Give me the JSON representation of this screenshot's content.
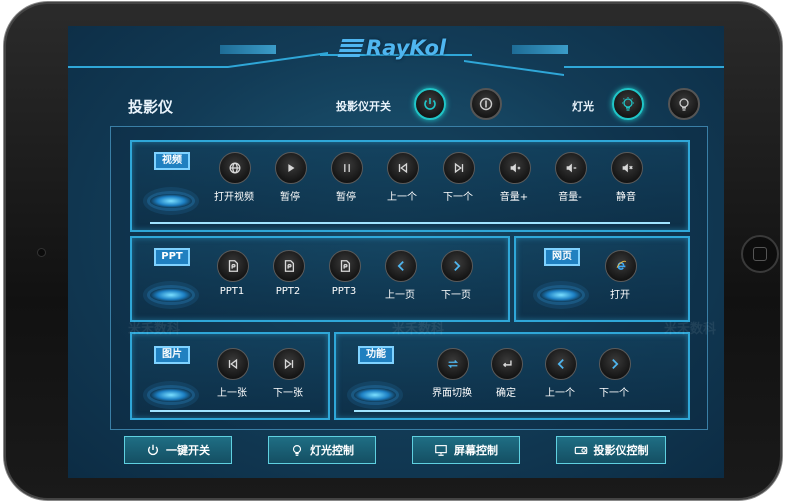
{
  "brand": {
    "logo": "RayKol"
  },
  "header": {
    "section_title": "投影仪",
    "projector_switch_label": "投影仪开关",
    "light_label": "灯光"
  },
  "video_panel": {
    "tag": "视频",
    "buttons": [
      {
        "label": "打开视频",
        "icon": "globe-icon"
      },
      {
        "label": "暂停",
        "icon": "play-icon"
      },
      {
        "label": "暂停",
        "icon": "pause-icon"
      },
      {
        "label": "上一个",
        "icon": "skip-back-icon"
      },
      {
        "label": "下一个",
        "icon": "skip-forward-icon"
      },
      {
        "label": "音量+",
        "icon": "volume-up-icon"
      },
      {
        "label": "音量-",
        "icon": "volume-down-icon"
      },
      {
        "label": "静音",
        "icon": "mute-icon"
      }
    ]
  },
  "ppt_panel": {
    "tag": "PPT",
    "buttons": [
      {
        "label": "PPT1",
        "icon": "ppt-file-icon"
      },
      {
        "label": "PPT2",
        "icon": "ppt-file-icon"
      },
      {
        "label": "PPT3",
        "icon": "ppt-file-icon"
      },
      {
        "label": "上一页",
        "icon": "chevron-left-icon"
      },
      {
        "label": "下一页",
        "icon": "chevron-right-icon"
      }
    ]
  },
  "web_panel": {
    "tag": "网页",
    "buttons": [
      {
        "label": "打开",
        "icon": "ie-browser-icon"
      }
    ]
  },
  "image_panel": {
    "tag": "图片",
    "buttons": [
      {
        "label": "上一张",
        "icon": "skip-back-icon"
      },
      {
        "label": "下一张",
        "icon": "skip-forward-icon"
      }
    ]
  },
  "function_panel": {
    "tag": "功能",
    "buttons": [
      {
        "label": "界面切换",
        "icon": "switch-icon"
      },
      {
        "label": "确定",
        "icon": "enter-icon"
      },
      {
        "label": "上一个",
        "icon": "chevron-left-icon"
      },
      {
        "label": "下一个",
        "icon": "chevron-right-icon"
      }
    ]
  },
  "bottom_nav": [
    {
      "label": "一键开关",
      "icon": "power-icon"
    },
    {
      "label": "灯光控制",
      "icon": "bulb-icon"
    },
    {
      "label": "屏幕控制",
      "icon": "monitor-icon"
    },
    {
      "label": "投影仪控制",
      "icon": "projector-icon"
    }
  ],
  "watermark": "米禾数科",
  "colors": {
    "accent": "#2fa7d8",
    "active_ring": "#20c6c8",
    "background": "#123b56"
  }
}
